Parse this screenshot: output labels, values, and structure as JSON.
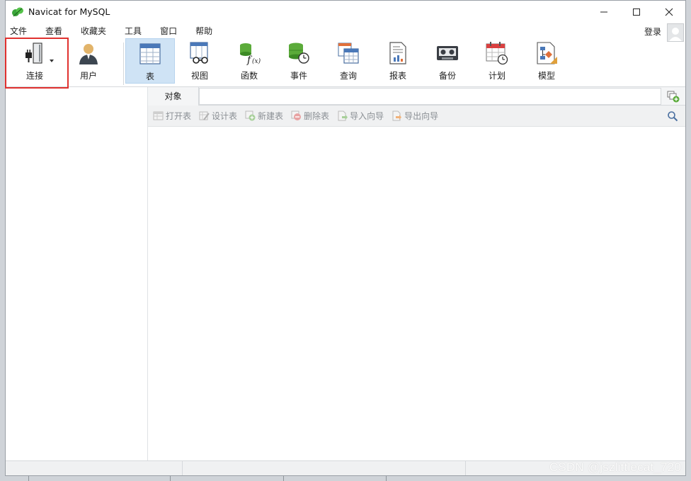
{
  "window": {
    "title": "Navicat for MySQL"
  },
  "menubar": {
    "items": [
      "文件",
      "查看",
      "收藏夹",
      "工具",
      "窗口",
      "帮助"
    ],
    "login_label": "登录"
  },
  "toolbar": {
    "buttons": [
      {
        "label": "连接",
        "icon": "connection-icon"
      },
      {
        "label": "用户",
        "icon": "user-icon"
      },
      {
        "label": "表",
        "icon": "table-icon",
        "active": true
      },
      {
        "label": "视图",
        "icon": "view-icon"
      },
      {
        "label": "函数",
        "icon": "function-icon"
      },
      {
        "label": "事件",
        "icon": "event-icon"
      },
      {
        "label": "查询",
        "icon": "query-icon"
      },
      {
        "label": "报表",
        "icon": "report-icon"
      },
      {
        "label": "备份",
        "icon": "backup-icon"
      },
      {
        "label": "计划",
        "icon": "schedule-icon"
      },
      {
        "label": "模型",
        "icon": "model-icon"
      }
    ],
    "highlight_color": "#e0312f"
  },
  "objects": {
    "tab_label": "对象",
    "actions": [
      {
        "label": "打开表",
        "icon": "open-table-icon"
      },
      {
        "label": "设计表",
        "icon": "design-table-icon"
      },
      {
        "label": "新建表",
        "icon": "new-table-icon"
      },
      {
        "label": "删除表",
        "icon": "delete-table-icon"
      },
      {
        "label": "导入向导",
        "icon": "import-wizard-icon"
      },
      {
        "label": "导出向导",
        "icon": "export-wizard-icon"
      }
    ]
  },
  "watermark": {
    "text": "CSDN @jszlittlecat_720"
  },
  "colors": {
    "active_button_bg": "#cfe3f5",
    "accent_red": "#e0312f"
  }
}
